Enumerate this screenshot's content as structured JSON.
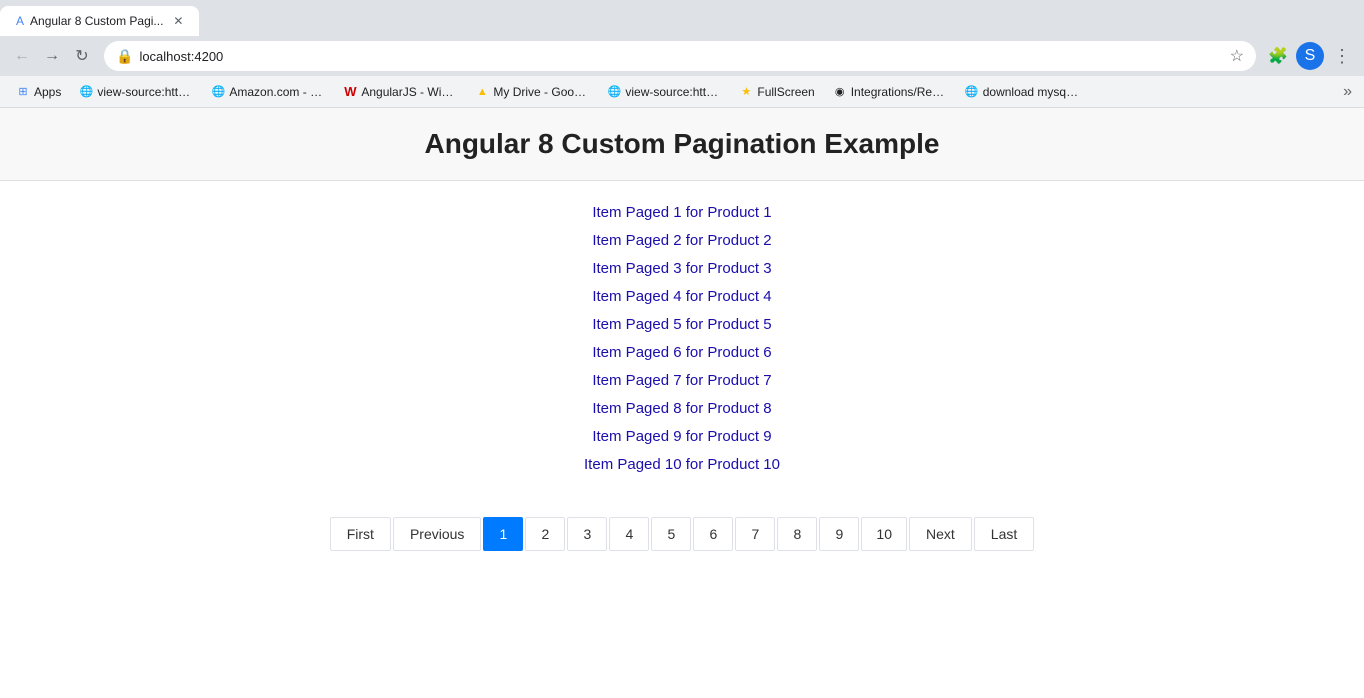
{
  "browser": {
    "url": "localhost:4200",
    "tabs": [
      {
        "label": "Angular 8 Custom Pagi..."
      }
    ]
  },
  "bookmarks": [
    {
      "label": "Apps",
      "favicon": "⊞",
      "color": "favicon-blue"
    },
    {
      "label": "view-source:https://...",
      "favicon": "🌐",
      "color": "favicon-blue"
    },
    {
      "label": "Amazon.com - Mar...",
      "favicon": "🌐",
      "color": "favicon-blue"
    },
    {
      "label": "AngularJS - Wikipe...",
      "favicon": "W",
      "color": ""
    },
    {
      "label": "My Drive - Google...",
      "favicon": "▲",
      "color": "favicon-yellow"
    },
    {
      "label": "view-source:https://...",
      "favicon": "🌐",
      "color": "favicon-blue"
    },
    {
      "label": "FullScreen",
      "favicon": "★",
      "color": "favicon-yellow"
    },
    {
      "label": "Integrations/Report...",
      "favicon": "◉",
      "color": ""
    },
    {
      "label": "download mysql w...",
      "favicon": "🌐",
      "color": "favicon-blue"
    }
  ],
  "page": {
    "title": "Angular 8 Custom Pagination Example",
    "items": [
      "Item Paged 1 for Product 1",
      "Item Paged 2 for Product 2",
      "Item Paged 3 for Product 3",
      "Item Paged 4 for Product 4",
      "Item Paged 5 for Product 5",
      "Item Paged 6 for Product 6",
      "Item Paged 7 for Product 7",
      "Item Paged 8 for Product 8",
      "Item Paged 9 for Product 9",
      "Item Paged 10 for Product 10"
    ],
    "pagination": {
      "first_label": "First",
      "previous_label": "Previous",
      "next_label": "Next",
      "last_label": "Last",
      "pages": [
        "1",
        "2",
        "3",
        "4",
        "5",
        "6",
        "7",
        "8",
        "9",
        "10"
      ],
      "active_page": "1"
    }
  }
}
